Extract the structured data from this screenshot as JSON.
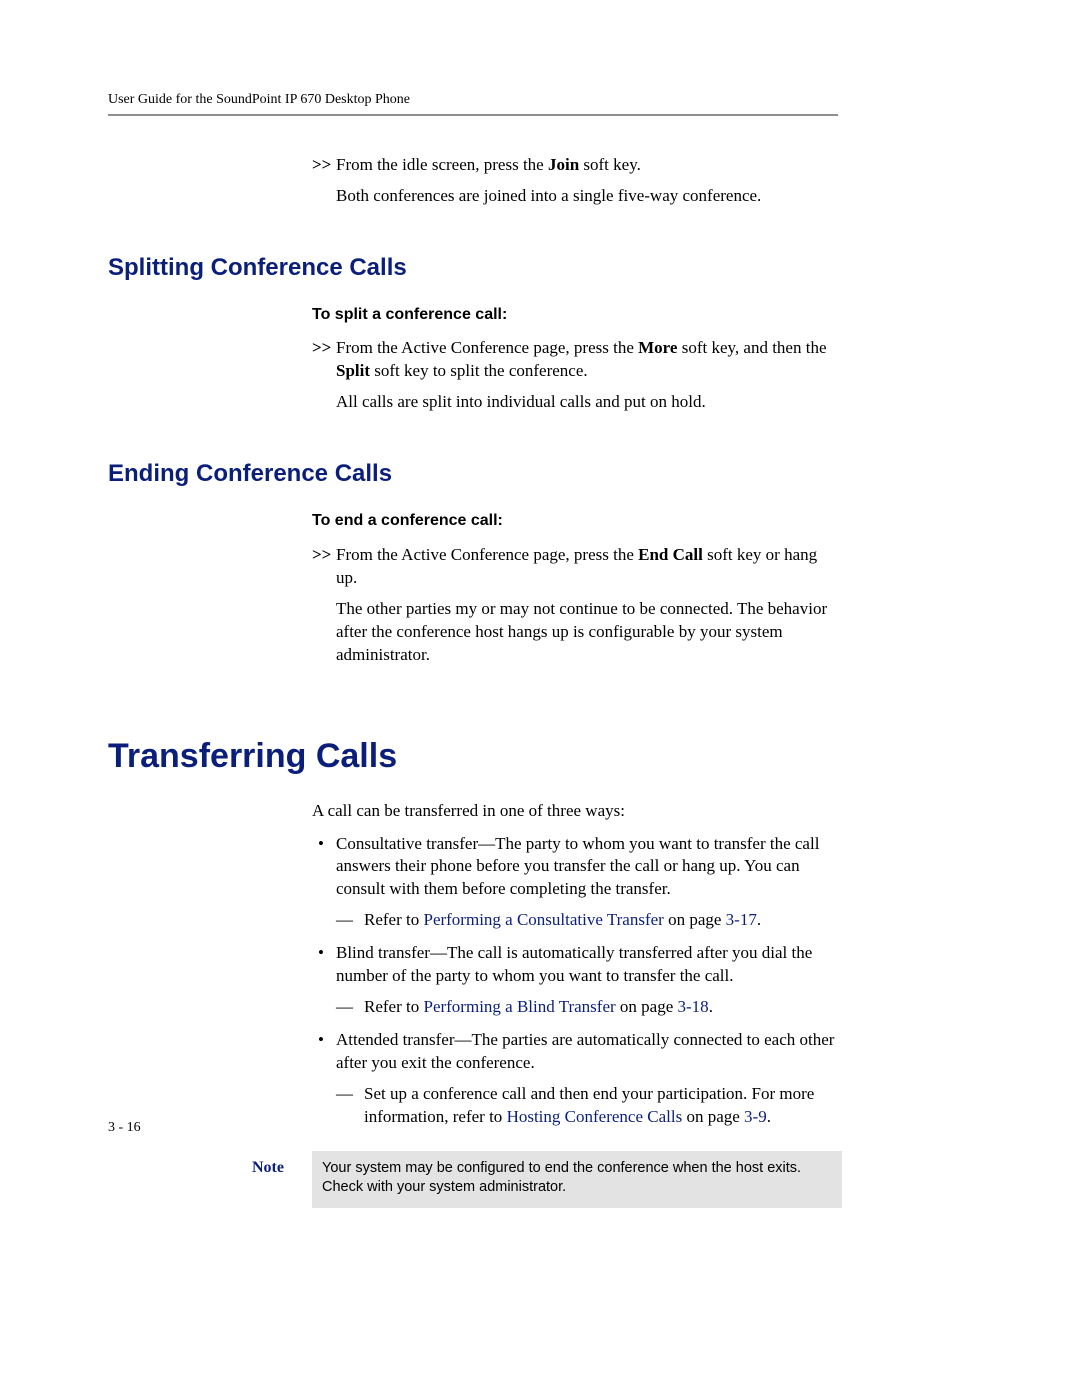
{
  "running_head": "User Guide for the SoundPoint IP 670 Desktop Phone",
  "intro": {
    "step_marker": ">>",
    "step_pre": "From the idle screen, press the ",
    "step_bold": "Join",
    "step_post": " soft key.",
    "result": "Both conferences are joined into a single five-way conference."
  },
  "split": {
    "heading": "Splitting Conference Calls",
    "task_title": "To split a conference call:",
    "step_marker": ">>",
    "step_pre": "From the Active Conference page, press the ",
    "step_bold1": "More",
    "step_mid": " soft key, and then the ",
    "step_bold2": "Split",
    "step_post": " soft key to split the conference.",
    "result": "All calls are split into individual calls and put on hold."
  },
  "end": {
    "heading": "Ending Conference Calls",
    "task_title": "To end a conference call:",
    "step_marker": ">>",
    "step_pre": "From the Active Conference page, press the ",
    "step_bold": "End Call",
    "step_post": " soft key or hang up.",
    "result": "The other parties my or may not continue to be connected. The behavior after the conference host hangs up is configurable by your system administrator."
  },
  "transfer": {
    "heading": "Transferring Calls",
    "intro": "A call can be transferred in one of three ways:",
    "items": [
      {
        "text": "Consultative transfer—The party to whom you want to transfer the call answers their phone before you transfer the call or hang up. You can consult with them before completing the transfer.",
        "sub_pre": "Refer to ",
        "sub_link": "Performing a Consultative Transfer",
        "sub_mid": " on page ",
        "sub_page": "3-17",
        "sub_post": "."
      },
      {
        "text": "Blind transfer—The call is automatically transferred after you dial the number of the party to whom you want to transfer the call.",
        "sub_pre": "Refer to ",
        "sub_link": "Performing a Blind Transfer",
        "sub_mid": " on page ",
        "sub_page": "3-18",
        "sub_post": "."
      },
      {
        "text": "Attended transfer—The parties are automatically connected to each other after you exit the conference.",
        "sub_pre": "Set up a conference call and then end your participation. For more information, refer to ",
        "sub_link": "Hosting Conference Calls",
        "sub_mid": " on page ",
        "sub_page": "3-9",
        "sub_post": "."
      }
    ]
  },
  "note": {
    "label": "Note",
    "text": "Your system may be configured to end the conference when the host exits. Check with your system administrator."
  },
  "page_number": "3 - 16"
}
